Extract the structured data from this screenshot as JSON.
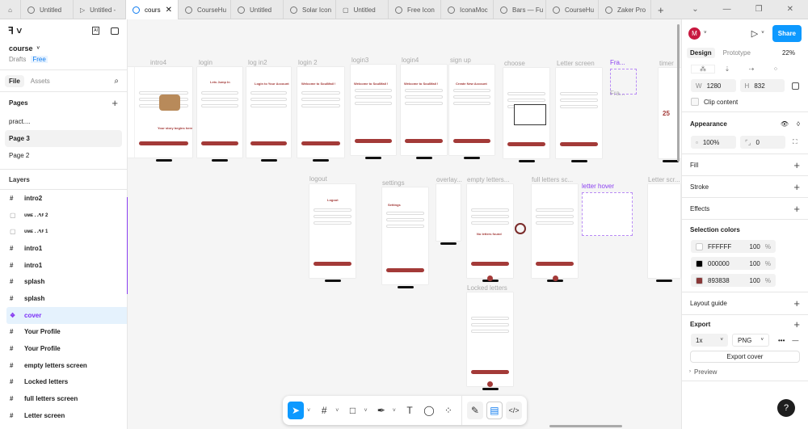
{
  "tabs": [
    {
      "label": "Untitled"
    },
    {
      "label": "Untitled -"
    },
    {
      "label": "cours"
    },
    {
      "label": "CourseHu"
    },
    {
      "label": "Untitled"
    },
    {
      "label": "Solar Icon"
    },
    {
      "label": "Untitled"
    },
    {
      "label": "Free Icon"
    },
    {
      "label": "IconaMoc"
    },
    {
      "label": "Bars — Fu"
    },
    {
      "label": "CourseHu"
    },
    {
      "label": "Zaker Pro"
    }
  ],
  "file": {
    "name": "course",
    "location": "Drafts",
    "plan": "Free"
  },
  "left_tabs": {
    "file": "File",
    "assets": "Assets"
  },
  "pages": {
    "title": "Pages",
    "items": [
      "pract....",
      "Page 3",
      "Page 2"
    ]
  },
  "layers": {
    "title": "Layers",
    "items": [
      "intro2",
      "ᴜᴍᴇ      . ،۹۶ 2",
      "ᴜᴍᴇ      . ،۹۶ 1",
      "intro1",
      "intro1",
      "splash",
      "splash",
      "cover",
      "Your Profile",
      "Your Profile",
      "empty letters screen",
      "Locked letters",
      "full  letters screen",
      "Letter screen"
    ]
  },
  "canvas": {
    "frames": [
      "intro4",
      "login",
      "log in2",
      "login 2",
      "login3",
      "login4",
      "sign up",
      "choose",
      "Letter screen",
      "Fra...",
      "timer",
      "logout",
      "settings",
      "overlay...",
      "empty letters...",
      "full  letters sc...",
      "letter hover",
      "Letter scr...",
      "Locked letters"
    ],
    "mini": {
      "login_title": "Lets Jump In",
      "login2_title": "Login to Your Account",
      "welcome": "Welcome to SoulMail !",
      "signup_title": "Create New Account",
      "logout_title": "Logout",
      "settings_title": "Settings",
      "intro_text": "Your story begins here",
      "no_letters": "No letters found",
      "timer_num": "25",
      "fra_sub": "Fra..."
    }
  },
  "right": {
    "avatar": "M",
    "share": "Share",
    "tabs": {
      "design": "Design",
      "prototype": "Prototype"
    },
    "zoom": "22%",
    "w_label": "W",
    "w": "1280",
    "h_label": "H",
    "h": "832",
    "clip": "Clip content",
    "appearance": "Appearance",
    "opacity": "100%",
    "radius": "0",
    "fill": "Fill",
    "stroke": "Stroke",
    "effects": "Effects",
    "selection_colors": "Selection colors",
    "colors": [
      {
        "hex": "FFFFFF",
        "opacity": "100",
        "pct": "%",
        "swatch": "#FFFFFF"
      },
      {
        "hex": "000000",
        "opacity": "100",
        "pct": "%",
        "swatch": "#000000"
      },
      {
        "hex": "893838",
        "opacity": "100",
        "pct": "%",
        "swatch": "#893838"
      }
    ],
    "layout_guide": "Layout guide",
    "export": "Export",
    "scale": "1x",
    "format": "PNG",
    "export_btn": "Export cover",
    "preview": "Preview",
    "help": "?"
  },
  "accent": "#0d99ff"
}
